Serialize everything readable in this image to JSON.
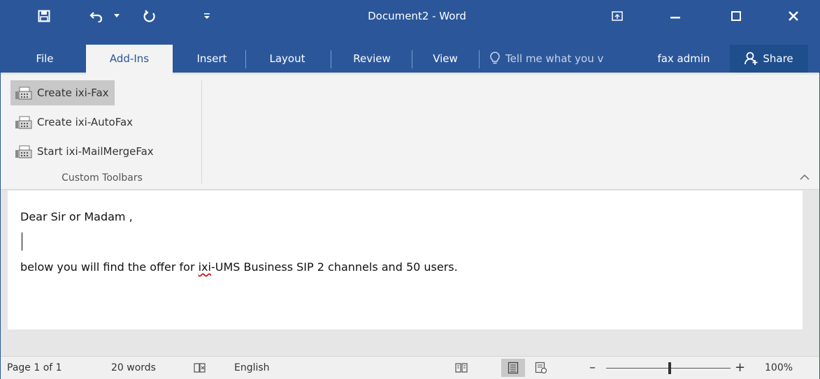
{
  "titlebar": {
    "title": "Document2 - Word",
    "icons": [
      "save-icon",
      "undo-icon",
      "dropdown-icon",
      "redo-icon",
      "customize-qat-icon",
      "ribbon-display-options-icon",
      "minimize-icon",
      "maximize-icon",
      "close-icon"
    ],
    "accent": "#2b579a"
  },
  "tabs": [
    {
      "label": "File"
    },
    {
      "label": "Add-Ins",
      "active": true
    },
    {
      "label": "Insert"
    },
    {
      "label": "Layout"
    },
    {
      "label": "Review"
    },
    {
      "label": "View"
    }
  ],
  "tell_me": {
    "placeholder": "Tell me what you v"
  },
  "user": {
    "name": "fax admin"
  },
  "share": {
    "label": "Share"
  },
  "ribbon": {
    "commands": [
      {
        "label": "Create ixi-Fax",
        "hover": true
      },
      {
        "label": "Create ixi-AutoFax"
      },
      {
        "label": "Start ixi-MailMergeFax"
      }
    ],
    "group_label": "Custom Toolbars"
  },
  "document": {
    "line1": "Dear Sir or Madam ,",
    "line3_before": "below you will find the offer for ",
    "line3_misspelled": "ixi",
    "line3_after": "-UMS Business SIP 2 channels and 50 users."
  },
  "status": {
    "page": "Page 1 of 1",
    "words": "20 words",
    "language": "English",
    "zoom": "100%",
    "zoom_level": 1.0
  }
}
